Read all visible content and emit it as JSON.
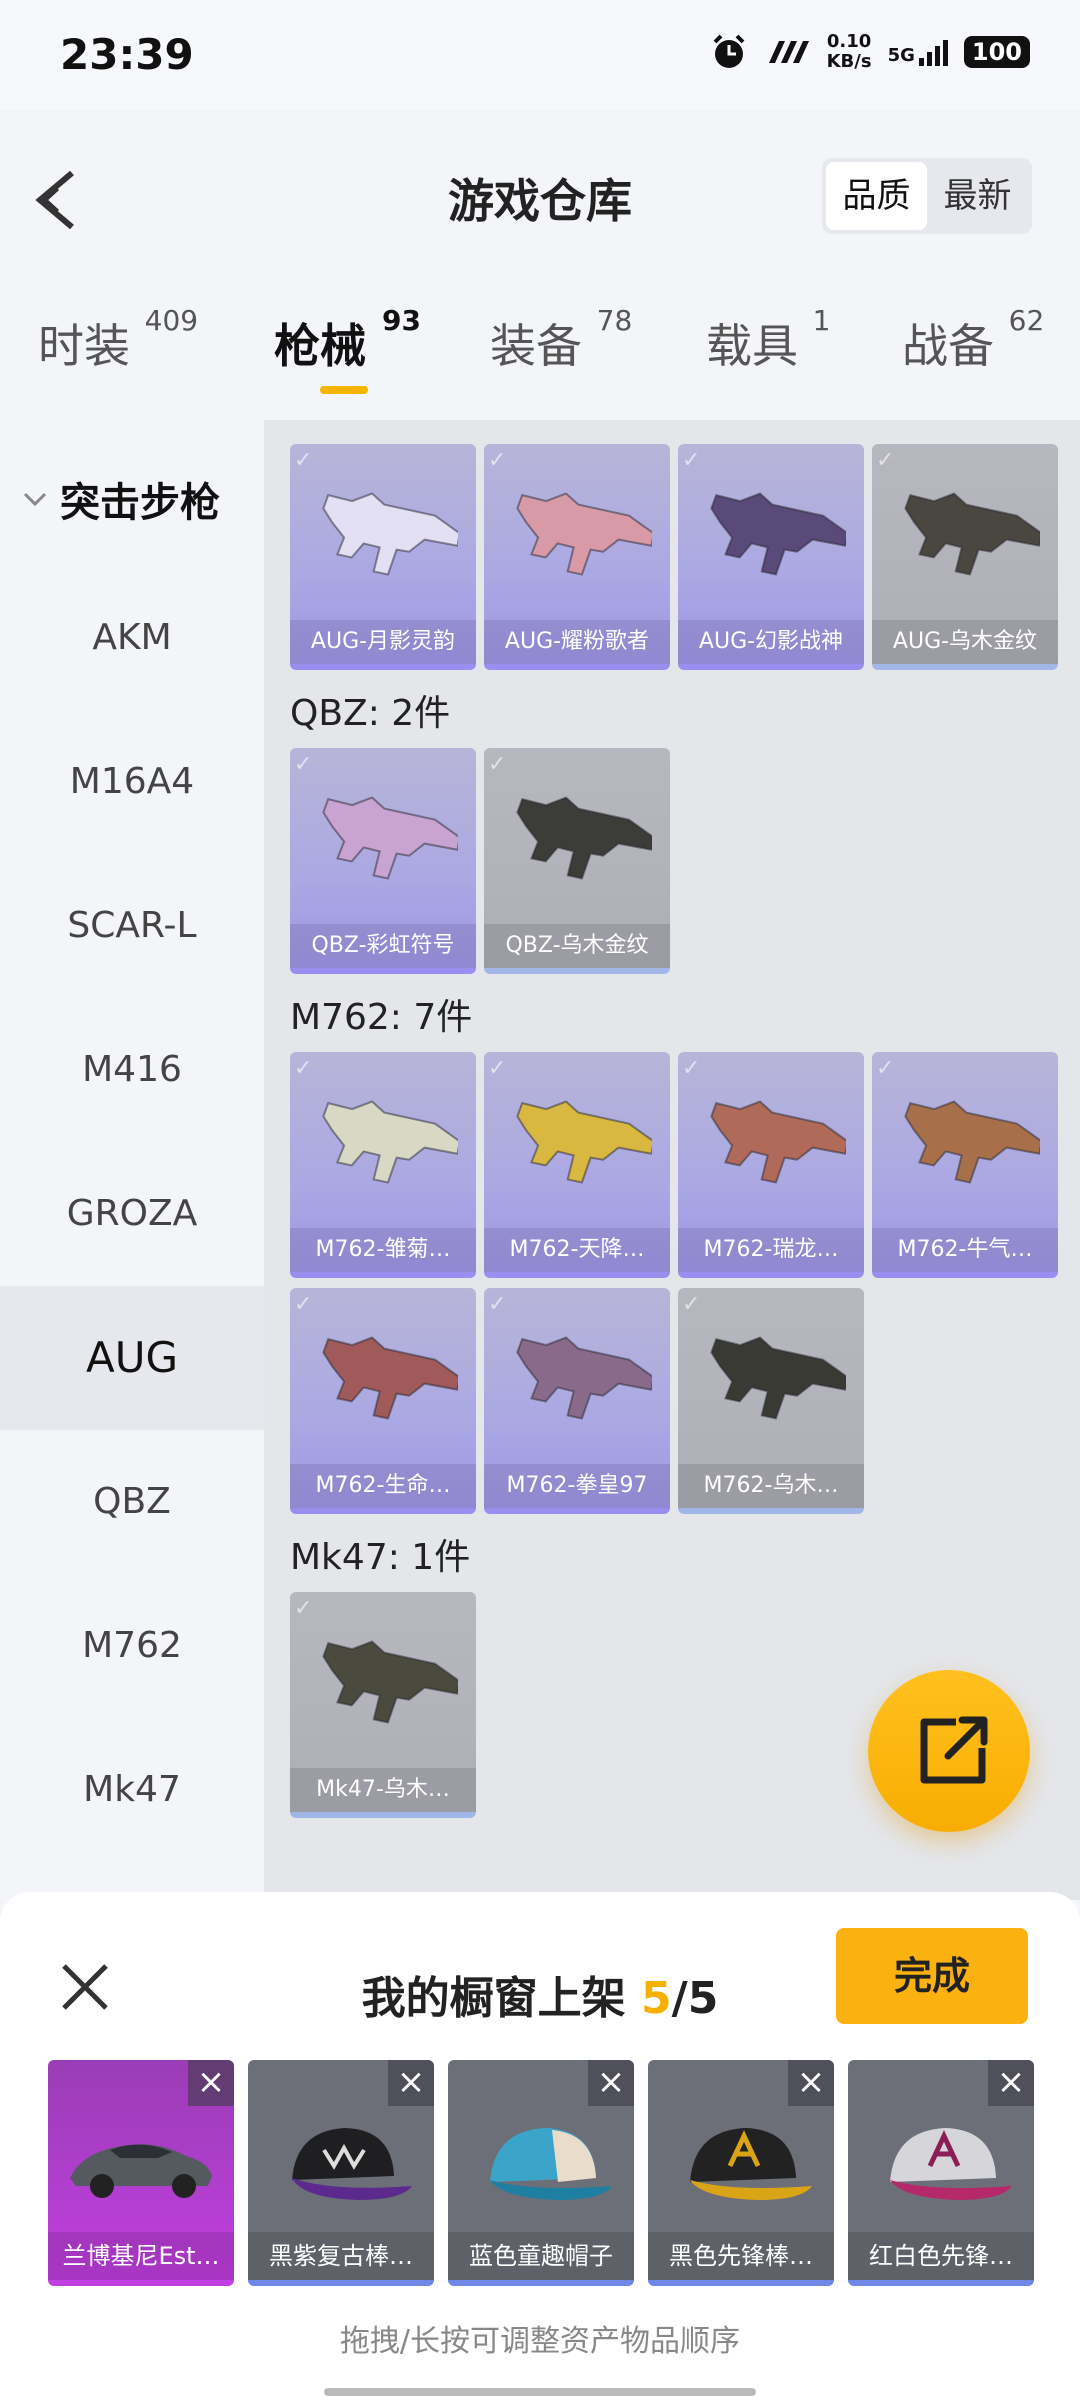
{
  "status": {
    "time": "23:39",
    "speed_value": "0.10",
    "speed_unit": "KB/s",
    "network": "5G",
    "battery": "100"
  },
  "header": {
    "title": "游戏仓库",
    "sort_options": [
      "品质",
      "最新"
    ],
    "active_sort": "品质"
  },
  "categories": [
    {
      "label": "时装",
      "count": "409"
    },
    {
      "label": "枪械",
      "count": "93"
    },
    {
      "label": "装备",
      "count": "78"
    },
    {
      "label": "载具",
      "count": "1"
    },
    {
      "label": "战备",
      "count": "62"
    }
  ],
  "sidebar": {
    "group": "突击步枪",
    "items": [
      "AKM",
      "M16A4",
      "SCAR-L",
      "M416",
      "GROZA",
      "AUG",
      "QBZ",
      "M762",
      "Mk47"
    ],
    "active": "AUG"
  },
  "sections": [
    {
      "title": "",
      "items": [
        {
          "name": "AUG-月影灵韵",
          "tone": "purple"
        },
        {
          "name": "AUG-耀粉歌者",
          "tone": "purple"
        },
        {
          "name": "AUG-幻影战神",
          "tone": "purple"
        },
        {
          "name": "AUG-乌木金纹",
          "tone": "grey"
        }
      ]
    },
    {
      "title": "QBZ: 2件",
      "items": [
        {
          "name": "QBZ-彩虹符号",
          "tone": "purple"
        },
        {
          "name": "QBZ-乌木金纹",
          "tone": "grey"
        }
      ]
    },
    {
      "title": "M762: 7件",
      "items": [
        {
          "name": "M762-雏菊…",
          "tone": "purple"
        },
        {
          "name": "M762-天降…",
          "tone": "purple"
        },
        {
          "name": "M762-瑞龙…",
          "tone": "purple"
        },
        {
          "name": "M762-牛气…",
          "tone": "purple"
        },
        {
          "name": "M762-生命…",
          "tone": "purple"
        },
        {
          "name": "M762-拳皇97",
          "tone": "purple"
        },
        {
          "name": "M762-乌木…",
          "tone": "grey"
        }
      ]
    },
    {
      "title": "Mk47: 1件",
      "items": [
        {
          "name": "Mk47-乌木…",
          "tone": "grey"
        }
      ]
    }
  ],
  "showcase": {
    "title_prefix": "我的橱窗上架",
    "current": "5",
    "separator": "/",
    "total": "5",
    "done_label": "完成",
    "items": [
      "兰博基尼Est…",
      "黑紫复古棒…",
      "蓝色童趣帽子",
      "黑色先锋棒…",
      "红白色先锋…"
    ],
    "hint": "拖拽/长按可调整资产物品顺序"
  },
  "colors": {
    "accent": "#f5b400",
    "done_button": "#fbb10f",
    "card_purple": "#aba8e3",
    "card_grey": "#aeaeb7"
  }
}
